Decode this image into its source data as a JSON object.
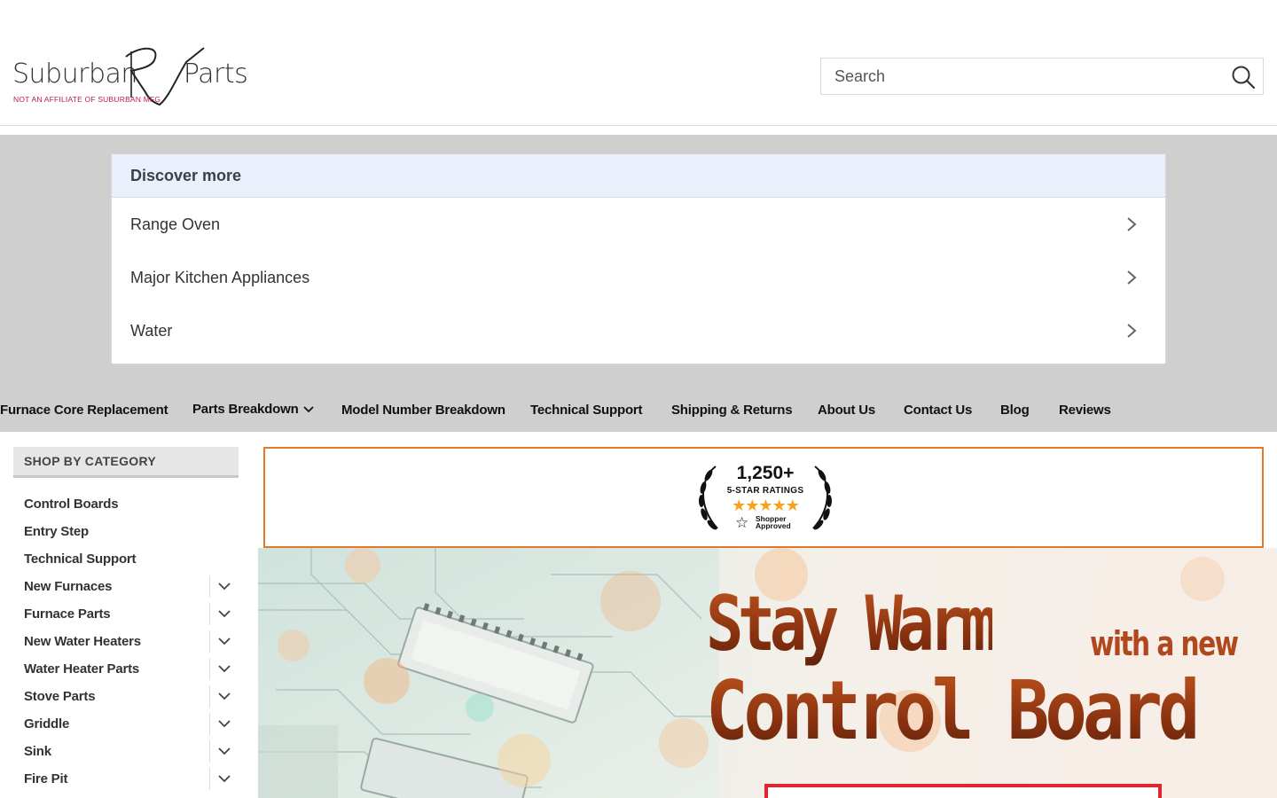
{
  "header": {
    "logo": {
      "word1": "Suburban",
      "word2": "Parts",
      "mark": "RV",
      "tagline": "NOT AN AFFILIATE OF SUBURBAN MFG."
    },
    "search": {
      "placeholder": "Search",
      "icon": "search-icon"
    }
  },
  "discover": {
    "title": "Discover more",
    "items": [
      {
        "label": "Range Oven"
      },
      {
        "label": "Major Kitchen Appliances"
      },
      {
        "label": "Water"
      }
    ]
  },
  "nav": {
    "items": [
      {
        "label": "Furnace Core Replacement"
      },
      {
        "label": "Parts Breakdown",
        "has_dropdown": true
      },
      {
        "label": "Model Number Breakdown"
      },
      {
        "label": "Technical Support"
      },
      {
        "label": "Shipping & Returns"
      },
      {
        "label": "About Us"
      },
      {
        "label": "Contact Us"
      },
      {
        "label": "Blog"
      },
      {
        "label": "Reviews"
      }
    ]
  },
  "sidebar": {
    "title": "SHOP BY CATEGORY",
    "items": [
      {
        "label": "Control Boards",
        "expandable": false
      },
      {
        "label": "Entry Step",
        "expandable": false
      },
      {
        "label": "Technical Support",
        "expandable": false
      },
      {
        "label": "New Furnaces",
        "expandable": true
      },
      {
        "label": "Furnace Parts",
        "expandable": true
      },
      {
        "label": "New Water Heaters",
        "expandable": true
      },
      {
        "label": "Water Heater Parts",
        "expandable": true
      },
      {
        "label": "Stove Parts",
        "expandable": true
      },
      {
        "label": "Griddle",
        "expandable": true
      },
      {
        "label": "Sink",
        "expandable": true
      },
      {
        "label": "Fire Pit",
        "expandable": true
      }
    ]
  },
  "ratings_badge": {
    "count": "1,250+",
    "label": "5-STAR RATINGS",
    "stars": "★★★★★",
    "source_line1": "Shopper",
    "source_line2": "Approved"
  },
  "hero": {
    "line1": "Stay Warm",
    "line1_small": "with a new",
    "line2": "Control Board"
  },
  "colors": {
    "badge_border": "#e4782a",
    "star": "#f6a21a",
    "hero_text": "#a33d14",
    "cta_border": "#e0272f",
    "logo_tagline": "#c2185b"
  }
}
